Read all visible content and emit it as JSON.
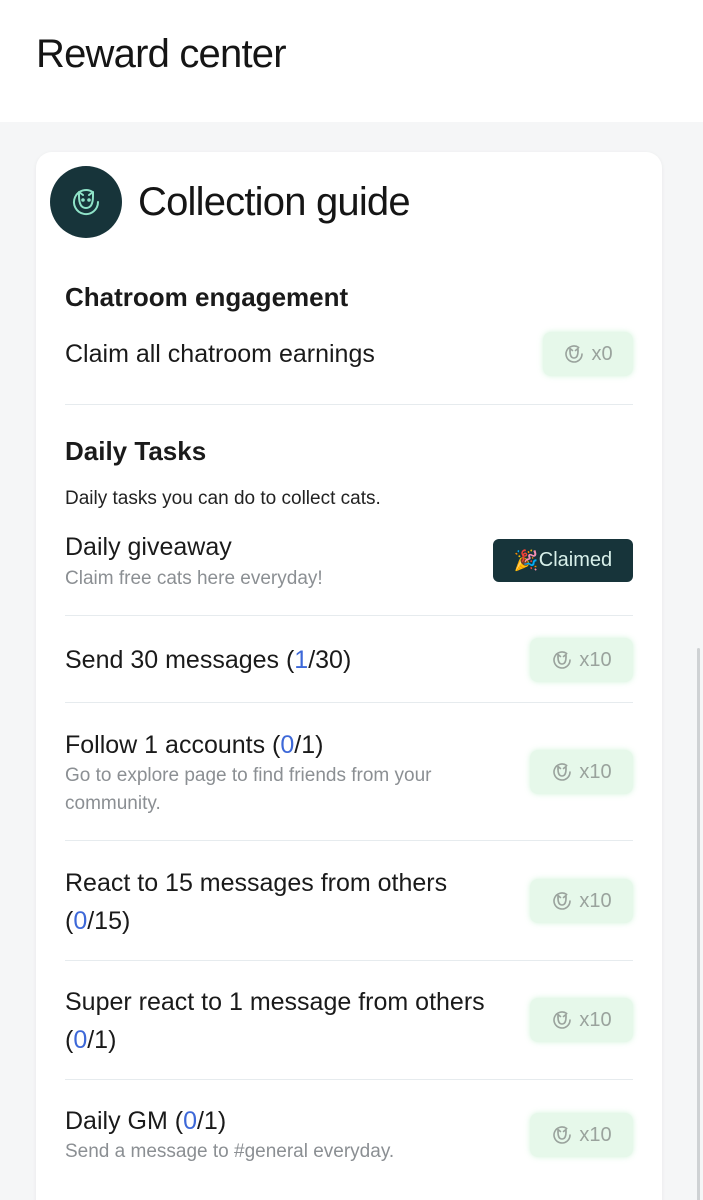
{
  "header": {
    "title": "Reward center"
  },
  "card": {
    "title": "Collection guide",
    "brand_icon": "cat-face-icon"
  },
  "chatroom": {
    "title": "Chatroom engagement",
    "task": {
      "title": "Claim all chatroom earnings",
      "reward": "x0"
    }
  },
  "daily": {
    "title": "Daily Tasks",
    "description": "Daily tasks  you can do to collect cats.",
    "giveaway": {
      "title": "Daily giveaway",
      "subtitle": "Claim free cats here everyday!",
      "button_emoji": "🎉",
      "button_label": "Claimed"
    },
    "tasks": [
      {
        "pre": "Send 30 messages (",
        "progress": "1",
        "post": "/30)",
        "subtitle": "",
        "reward": "x10"
      },
      {
        "pre": "Follow 1 accounts (",
        "progress": "0",
        "post": "/1)",
        "subtitle": "Go to explore page to find friends from your community.",
        "reward": "x10"
      },
      {
        "pre": "React to 15 messages from others (",
        "progress": "0",
        "post": "/15)",
        "subtitle": "",
        "reward": "x10"
      },
      {
        "pre": "Super react to 1 message from others (",
        "progress": "0",
        "post": "/1)",
        "subtitle": "",
        "reward": "x10"
      },
      {
        "pre": "Daily GM (",
        "progress": "0",
        "post": "/1)",
        "subtitle": "Send a message to #general everyday.",
        "reward": "x10"
      }
    ]
  },
  "colors": {
    "brand_dark": "#17343a",
    "progress_blue": "#3d68d8",
    "reward_bg": "#e6f8ea"
  }
}
